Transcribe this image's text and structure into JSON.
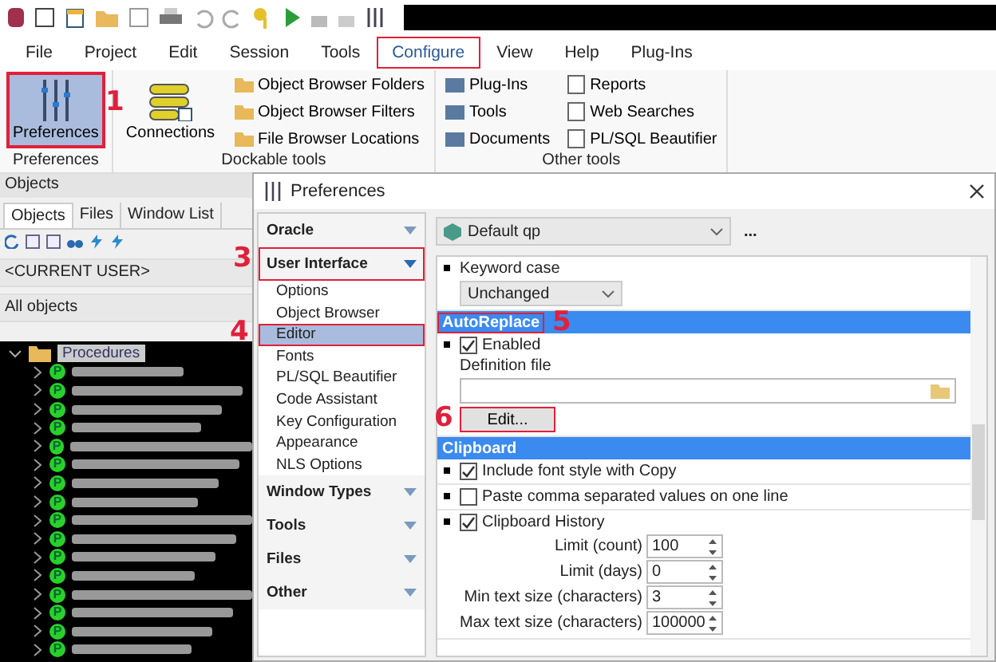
{
  "menu": [
    {
      "label": "File",
      "highlighted": false
    },
    {
      "label": "Project",
      "highlighted": false
    },
    {
      "label": "Edit",
      "highlighted": false
    },
    {
      "label": "Session",
      "highlighted": false
    },
    {
      "label": "Tools",
      "highlighted": false
    },
    {
      "label": "Configure",
      "highlighted": true
    },
    {
      "label": "View",
      "highlighted": false
    },
    {
      "label": "Help",
      "highlighted": false
    },
    {
      "label": "Plug-Ins",
      "highlighted": false
    }
  ],
  "ribbon": {
    "preferences": {
      "label": "Preferences",
      "selected": true,
      "highlighted": true,
      "annotation": "1",
      "group": "Preferences"
    },
    "connections": {
      "label": "Connections"
    },
    "dockable": [
      "Object Browser Folders",
      "Object Browser Filters",
      "File Browser Locations"
    ],
    "dockable_group": "Dockable tools",
    "other_col1": [
      "Plug-Ins",
      "Tools",
      "Documents"
    ],
    "other_col2": [
      "Reports",
      "Web Searches",
      "PL/SQL Beautifier"
    ],
    "other_group": "Other tools"
  },
  "objects_panel": {
    "title": "Objects",
    "tabs": [
      {
        "label": "Objects",
        "selected": true
      },
      {
        "label": "Files",
        "selected": false
      },
      {
        "label": "Window List",
        "selected": false
      }
    ],
    "user": "<CURRENT USER>",
    "filter": "All objects",
    "tree": {
      "label": "Procedures",
      "expanded": true,
      "children": [
        {
          "badge": "P",
          "redacted": true
        },
        {
          "badge": "P",
          "redacted": true
        },
        {
          "badge": "P",
          "redacted": true
        },
        {
          "badge": "P",
          "redacted": true
        },
        {
          "badge": "P",
          "redacted": true
        },
        {
          "badge": "P",
          "redacted": true
        },
        {
          "badge": "P",
          "redacted": true
        },
        {
          "badge": "P",
          "redacted": true
        },
        {
          "badge": "P",
          "redacted": true
        },
        {
          "badge": "P",
          "redacted": true
        },
        {
          "badge": "P",
          "redacted": true
        },
        {
          "badge": "P",
          "redacted": true
        },
        {
          "badge": "P",
          "redacted": true
        },
        {
          "badge": "P",
          "redacted": true
        },
        {
          "badge": "P",
          "redacted": true
        },
        {
          "badge": "P",
          "redacted": true
        }
      ]
    }
  },
  "dialog": {
    "title": "Preferences",
    "nav": [
      {
        "label": "Oracle",
        "expanded": false,
        "highlighted": false
      },
      {
        "label": "User Interface",
        "expanded": true,
        "highlighted": true,
        "annotation": "3",
        "children": [
          {
            "label": "Options",
            "selected": false,
            "highlighted": false
          },
          {
            "label": "Object Browser",
            "selected": false,
            "highlighted": false
          },
          {
            "label": "Editor",
            "selected": true,
            "highlighted": true,
            "annotation": "4"
          },
          {
            "label": "Fonts",
            "selected": false,
            "highlighted": false
          },
          {
            "label": "PL/SQL Beautifier",
            "selected": false,
            "highlighted": false
          },
          {
            "label": "Code Assistant",
            "selected": false,
            "highlighted": false
          },
          {
            "label": "Key Configuration",
            "selected": false,
            "highlighted": false
          },
          {
            "label": "Appearance",
            "selected": false,
            "highlighted": false
          },
          {
            "label": "NLS Options",
            "selected": false,
            "highlighted": false
          }
        ]
      },
      {
        "label": "Window Types",
        "expanded": false,
        "highlighted": false
      },
      {
        "label": "Tools",
        "expanded": false,
        "highlighted": false
      },
      {
        "label": "Files",
        "expanded": false,
        "highlighted": false
      },
      {
        "label": "Other",
        "expanded": false,
        "highlighted": false
      }
    ],
    "profile": "Default qp",
    "more": "...",
    "keyword_case": {
      "label": "Keyword case",
      "value": "Unchanged"
    },
    "autoreplace": {
      "title": "AutoReplace",
      "highlighted": true,
      "annotation": "5",
      "enabled": {
        "label": "Enabled",
        "checked": true
      },
      "definition_label": "Definition file",
      "edit": {
        "label": "Edit...",
        "highlighted": true,
        "annotation": "6"
      }
    },
    "clipboard": {
      "title": "Clipboard",
      "options": [
        {
          "label": "Include font style with Copy",
          "checked": true
        },
        {
          "label": "Paste comma separated values on one line",
          "checked": false
        },
        {
          "label": "Clipboard History",
          "checked": true
        }
      ],
      "limits": [
        {
          "label": "Limit (count)",
          "value": "100"
        },
        {
          "label": "Limit (days)",
          "value": "0"
        },
        {
          "label": "Min text size (characters)",
          "value": "3"
        },
        {
          "label": "Max text size (characters)",
          "value": "100000"
        }
      ]
    }
  }
}
